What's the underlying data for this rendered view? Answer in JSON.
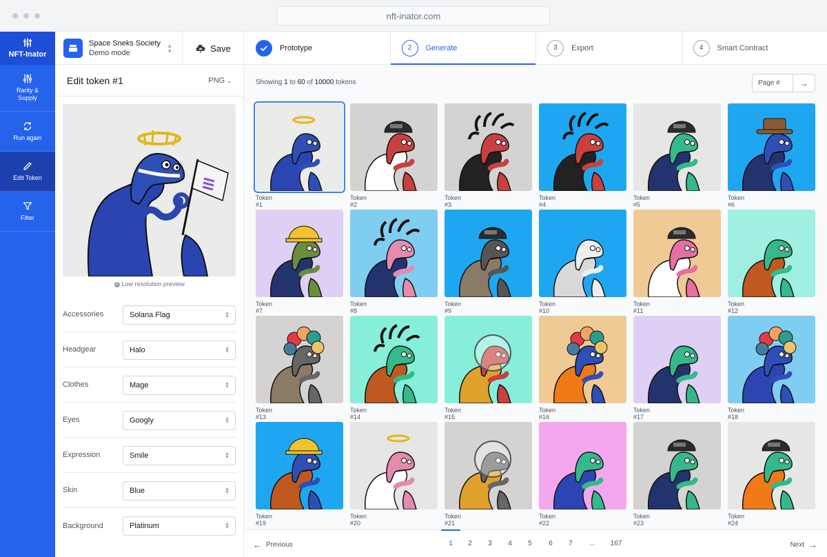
{
  "browser": {
    "url": "nft-inator.com"
  },
  "colors": {
    "accent": "#2563eb",
    "rail": "#2563eb",
    "rail_active": "#1e40af"
  },
  "sidebar": {
    "logo_label": "NFT-Inator",
    "items": [
      {
        "label": "Rarity & Supply",
        "icon": "sliders-icon"
      },
      {
        "label": "Run again",
        "icon": "refresh-icon"
      },
      {
        "label": "Edit Token",
        "icon": "pencil-icon",
        "active": true
      },
      {
        "label": "Filter",
        "icon": "filter-icon"
      }
    ]
  },
  "project": {
    "name": "Space Sneks Society",
    "mode": "Demo mode",
    "save_label": "Save"
  },
  "editor": {
    "title": "Edit token #1",
    "format": "PNG",
    "preview_note": "Low resolution preview",
    "attributes": [
      {
        "label": "Accessories",
        "value": "Solana Flag"
      },
      {
        "label": "Headgear",
        "value": "Halo"
      },
      {
        "label": "Clothes",
        "value": "Mage"
      },
      {
        "label": "Eyes",
        "value": "Googly"
      },
      {
        "label": "Expression",
        "value": "Smile"
      },
      {
        "label": "Skin",
        "value": "Blue"
      },
      {
        "label": "Background",
        "value": "Platinum"
      }
    ]
  },
  "steps": [
    {
      "num": "",
      "label": "Prototype",
      "done": true
    },
    {
      "num": "2",
      "label": "Generate",
      "active": true
    },
    {
      "num": "3",
      "label": "Export"
    },
    {
      "num": "4",
      "label": "Smart Contract"
    }
  ],
  "gallery": {
    "showing_prefix": "Showing",
    "from": "1",
    "to_word": "to",
    "to": "60",
    "of_word": "of",
    "total": "10000",
    "suffix": "tokens",
    "page_placeholder": "Page #",
    "tokens": [
      {
        "label": "Token #1",
        "bg": "#ebebe9",
        "skin": "#2f4fb8",
        "cloth": "#2b46b3",
        "head": "halo",
        "selected": true
      },
      {
        "label": "Token #2",
        "bg": "#d4d3d2",
        "skin": "#c94040",
        "cloth": "#ffffff",
        "head": "helmet"
      },
      {
        "label": "Token #3",
        "bg": "#d4d3d2",
        "skin": "#c94040",
        "cloth": "#222222",
        "head": "dreads"
      },
      {
        "label": "Token #4",
        "bg": "#1ea7f0",
        "skin": "#c94040",
        "cloth": "#222222",
        "head": "dreads"
      },
      {
        "label": "Token #5",
        "bg": "#e6e6e4",
        "skin": "#35b98a",
        "cloth": "#23336e",
        "head": "helmet"
      },
      {
        "label": "Token #6",
        "bg": "#1ea7f0",
        "skin": "#2f4fb8",
        "cloth": "#23336e",
        "head": "cowboy"
      },
      {
        "label": "Token #7",
        "bg": "#ddd0f4",
        "skin": "#6a8d3c",
        "cloth": "#23336e",
        "head": "hardhat"
      },
      {
        "label": "Token #8",
        "bg": "#80cdf2",
        "skin": "#e58bb0",
        "cloth": "#23336e",
        "head": "dreads"
      },
      {
        "label": "Token #9",
        "bg": "#1ea7f0",
        "skin": "#555555",
        "cloth": "#8a7a66",
        "head": "helmet"
      },
      {
        "label": "Token #10",
        "bg": "#1ea7f0",
        "skin": "#eeeeee",
        "cloth": "#d9d9d9",
        "head": "none"
      },
      {
        "label": "Token #11",
        "bg": "#f0ca95",
        "skin": "#e56fa0",
        "cloth": "#ffffff",
        "head": "helmet"
      },
      {
        "label": "Token #12",
        "bg": "#9ff0e0",
        "skin": "#35b98a",
        "cloth": "#c0581f",
        "head": "none"
      },
      {
        "label": "Token #13",
        "bg": "#d4d3d2",
        "skin": "#666666",
        "cloth": "#8a7a66",
        "head": "afro"
      },
      {
        "label": "Token #14",
        "bg": "#87efd9",
        "skin": "#35b98a",
        "cloth": "#c0581f",
        "head": "dreads"
      },
      {
        "label": "Token #15",
        "bg": "#87efd9",
        "skin": "#c94040",
        "cloth": "#e0a02c",
        "head": "bubble"
      },
      {
        "label": "Token #16",
        "bg": "#f0ca95",
        "skin": "#2f4fb8",
        "cloth": "#f07a18",
        "head": "afro"
      },
      {
        "label": "Token #17",
        "bg": "#ddd0f4",
        "skin": "#35b98a",
        "cloth": "#23336e",
        "head": "none"
      },
      {
        "label": "Token #18",
        "bg": "#80cdf2",
        "skin": "#2f4fb8",
        "cloth": "#2b46b3",
        "head": "afro"
      },
      {
        "label": "Token #19",
        "bg": "#1ea7f0",
        "skin": "#2f4fb8",
        "cloth": "#c0581f",
        "head": "hardhat"
      },
      {
        "label": "Token #20",
        "bg": "#e6e6e4",
        "skin": "#e58bb0",
        "cloth": "#ffffff",
        "head": "halo"
      },
      {
        "label": "Token #21",
        "bg": "#d4d3d2",
        "skin": "#666666",
        "cloth": "#e0a02c",
        "head": "bubble"
      },
      {
        "label": "Token #22",
        "bg": "#f3a8ee",
        "skin": "#35b98a",
        "cloth": "#2b46b3",
        "head": "none"
      },
      {
        "label": "Token #23",
        "bg": "#d4d3d2",
        "skin": "#35b98a",
        "cloth": "#23336e",
        "head": "helmet"
      },
      {
        "label": "Token #24",
        "bg": "#e6e6e4",
        "skin": "#35b98a",
        "cloth": "#f07a18",
        "head": "helmet"
      }
    ]
  },
  "pagination": {
    "prev_label": "Previous",
    "next_label": "Next",
    "pages": [
      "1",
      "2",
      "3",
      "4",
      "5",
      "6",
      "7",
      "...",
      "167"
    ],
    "current": "1"
  }
}
